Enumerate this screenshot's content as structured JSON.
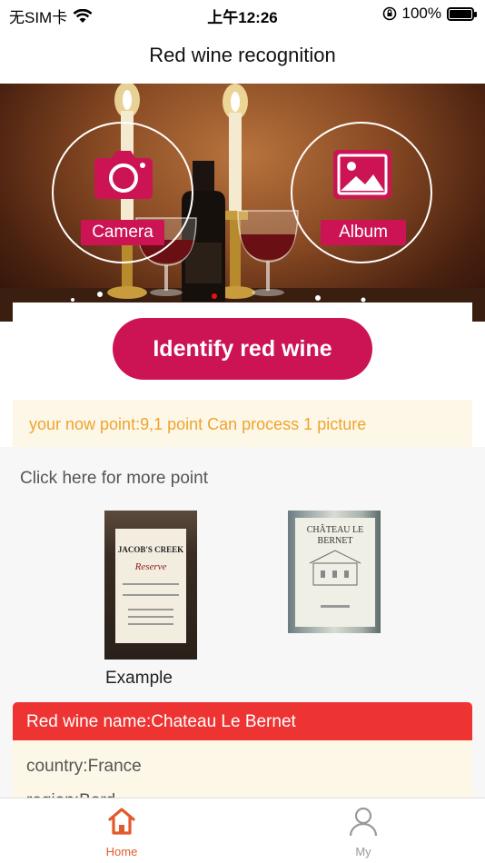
{
  "status_bar": {
    "carrier": "无SIM卡",
    "time": "上午12:26",
    "battery": "100%"
  },
  "nav": {
    "title": "Red wine recognition"
  },
  "hero": {
    "camera_label": "Camera",
    "album_label": "Album"
  },
  "main": {
    "identify_label": "Identify red wine",
    "points_text": "your now point:9,1 point Can process 1 picture",
    "more_point_text": "Click here for more point",
    "example_label": "Example",
    "sample1": {
      "brand": "JACOB'S CREEK",
      "script": "Reserve"
    },
    "sample2": {
      "brand": "CHÂTEAU LE BERNET"
    }
  },
  "result": {
    "name_line": "Red wine name:Chateau Le Bernet",
    "country_line": "country:France",
    "partial_line": "region:Bord..."
  },
  "tabs": [
    {
      "label": "Home",
      "icon": "home-icon",
      "active": true,
      "color": "#e25a2b"
    },
    {
      "label": "My",
      "icon": "person-icon",
      "active": false,
      "color": "#999999"
    }
  ],
  "colors": {
    "accent": "#cc1455",
    "points_text": "#f0a32e",
    "result_header": "#ee3333",
    "tab_active": "#e25a2b"
  }
}
